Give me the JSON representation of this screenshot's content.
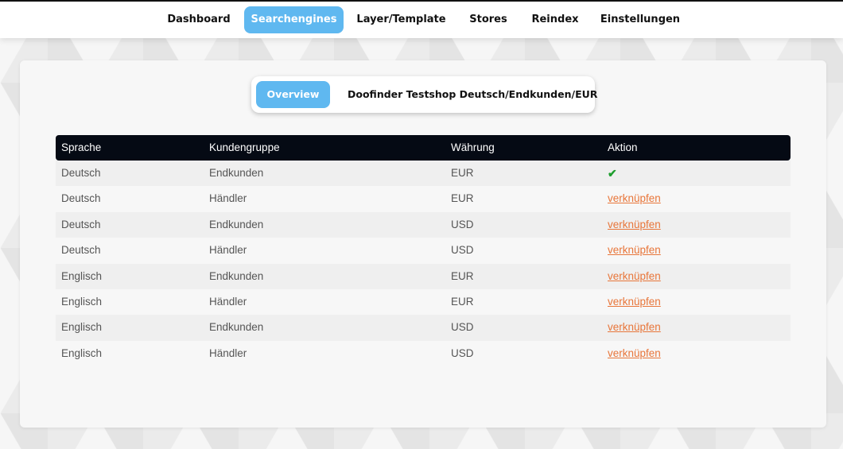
{
  "nav": {
    "items": [
      {
        "label": "Dashboard",
        "active": false
      },
      {
        "label": "Searchengines",
        "active": true
      },
      {
        "label": "Layer/Template",
        "active": false
      },
      {
        "label": "Stores",
        "active": false
      },
      {
        "label": "Reindex",
        "active": false
      },
      {
        "label": "Einstellungen",
        "active": false
      }
    ]
  },
  "subtabs": {
    "overview": "Overview",
    "engine": "Doofinder Testshop Deutsch/Endkunden/EUR"
  },
  "table": {
    "headers": [
      "Sprache",
      "Kundengruppe",
      "Währung",
      "Aktion"
    ],
    "link_label": "verknüpfen",
    "check_icon": "✔",
    "rows": [
      {
        "sprache": "Deutsch",
        "kundengruppe": "Endkunden",
        "waehrung": "EUR",
        "aktion": "linked"
      },
      {
        "sprache": "Deutsch",
        "kundengruppe": "Händler",
        "waehrung": "EUR",
        "aktion": "verknüpfen"
      },
      {
        "sprache": "Deutsch",
        "kundengruppe": "Endkunden",
        "waehrung": "USD",
        "aktion": "verknüpfen"
      },
      {
        "sprache": "Deutsch",
        "kundengruppe": "Händler",
        "waehrung": "USD",
        "aktion": "verknüpfen"
      },
      {
        "sprache": "Englisch",
        "kundengruppe": "Endkunden",
        "waehrung": "EUR",
        "aktion": "verknüpfen"
      },
      {
        "sprache": "Englisch",
        "kundengruppe": "Händler",
        "waehrung": "EUR",
        "aktion": "verknüpfen"
      },
      {
        "sprache": "Englisch",
        "kundengruppe": "Endkunden",
        "waehrung": "USD",
        "aktion": "verknüpfen"
      },
      {
        "sprache": "Englisch",
        "kundengruppe": "Händler",
        "waehrung": "USD",
        "aktion": "verknüpfen"
      }
    ]
  },
  "colors": {
    "accent": "#5fb8f0",
    "link": "#e8763a",
    "check": "#1e9e2e",
    "table_header": "#050a14"
  }
}
